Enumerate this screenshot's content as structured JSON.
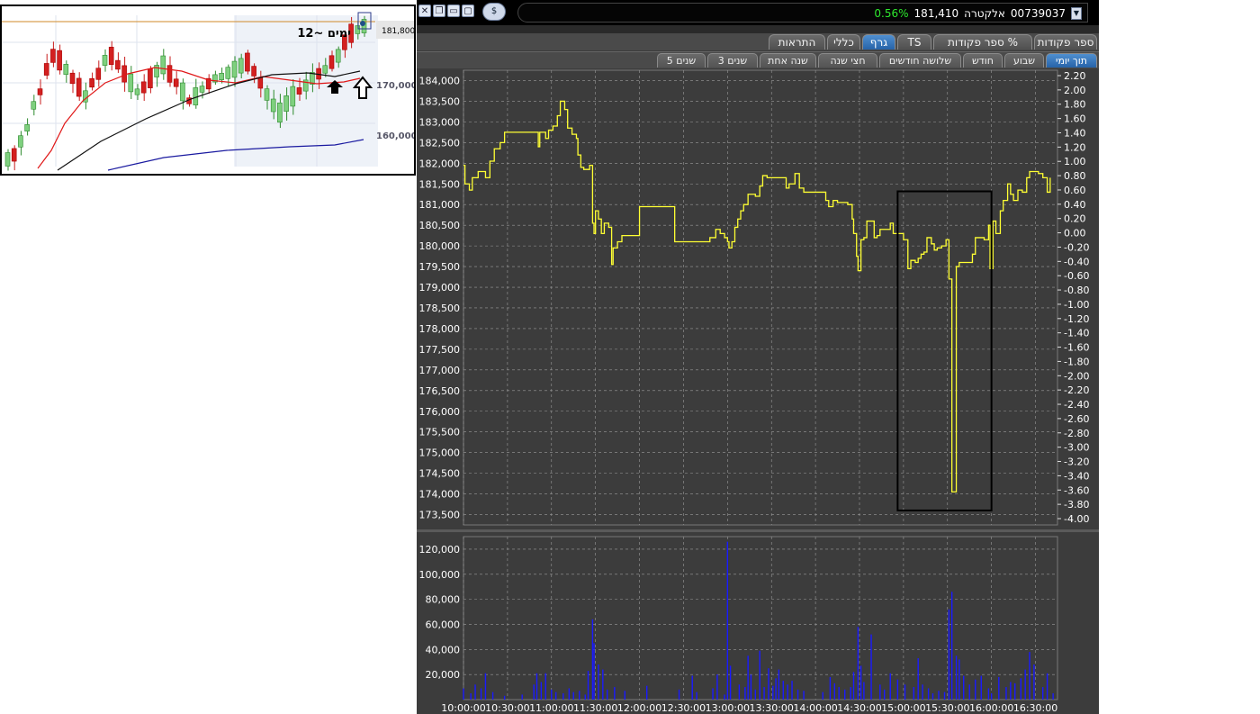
{
  "inset": {
    "annotation": "12~ ימים",
    "price_tag": "181,800",
    "y_labels": [
      "170,000",
      "160,000"
    ]
  },
  "window": {
    "buttons": [
      "close",
      "restore",
      "minimize",
      "maximize"
    ],
    "symbol_button": "$",
    "code": "00739037",
    "name": "אלקטרה",
    "price": "181,410",
    "change_pct": "0.56%"
  },
  "tabs": [
    {
      "label": "ספר פקודות",
      "active": false
    },
    {
      "label": "ספר פקודות %",
      "active": false
    },
    {
      "label": "TS",
      "active": false
    },
    {
      "label": "גרף",
      "active": true
    },
    {
      "label": "כללי",
      "active": false
    },
    {
      "label": "התראות",
      "active": false
    }
  ],
  "periods": [
    {
      "label": "תוך יומי",
      "active": true
    },
    {
      "label": "שבוע",
      "active": false
    },
    {
      "label": "חודש",
      "active": false
    },
    {
      "label": "שלושה חודשים",
      "active": false
    },
    {
      "label": "חצי שנה",
      "active": false
    },
    {
      "label": "שנה אחת",
      "active": false
    },
    {
      "label": "3 שנים",
      "active": false
    },
    {
      "label": "5 שנים",
      "active": false
    }
  ],
  "colors": {
    "chart_bg": "#3c3c3c",
    "grid": "#9a9a9a",
    "price_line": "#ffff33",
    "volume": "#1a1aff",
    "label": "#ffffff",
    "pct_green": "#2ee82e",
    "tab_active": "#2f72bb"
  },
  "chart_data": {
    "type": "line",
    "x_ticks": [
      "10:00:00",
      "10:30:00",
      "11:00:00",
      "11:30:00",
      "12:00:00",
      "12:30:00",
      "13:00:00",
      "13:30:00",
      "14:00:00",
      "14:30:00",
      "15:00:00",
      "15:30:00",
      "16:00:00",
      "16:30:00"
    ],
    "price": {
      "ylim": [
        173250,
        184250
      ],
      "ticks": [
        "184,000",
        "183,500",
        "183,000",
        "182,500",
        "182,000",
        "181,500",
        "181,000",
        "180,500",
        "180,000",
        "179,500",
        "179,000",
        "178,500",
        "178,000",
        "177,500",
        "177,000",
        "176,500",
        "176,000",
        "175,500",
        "175,000",
        "174,500",
        "174,000",
        "173,500"
      ],
      "pct_ticks": [
        "2.20",
        "2.00",
        "1.80",
        "1.60",
        "1.40",
        "1.20",
        "1.00",
        "0.80",
        "0.60",
        "0.40",
        "0.20",
        "0.00",
        "-0.20",
        "-0.40",
        "-0.60",
        "-0.80",
        "-1.00",
        "-1.20",
        "-1.40",
        "-1.60",
        "-1.80",
        "-2.00",
        "-2.20",
        "-2.40",
        "-2.60",
        "-2.80",
        "-3.00",
        "-3.20",
        "-3.40",
        "-3.60",
        "-3.80",
        "-4.00"
      ],
      "series": [
        [
          "10:00",
          181950
        ],
        [
          "10:01",
          181500
        ],
        [
          "10:04",
          181350
        ],
        [
          "10:06",
          181650
        ],
        [
          "10:10",
          181800
        ],
        [
          "10:15",
          181650
        ],
        [
          "10:18",
          182050
        ],
        [
          "10:21",
          182350
        ],
        [
          "10:25",
          182500
        ],
        [
          "10:28",
          182750
        ],
        [
          "10:50",
          182750
        ],
        [
          "10:51",
          182400
        ],
        [
          "10:52",
          182750
        ],
        [
          "10:56",
          182600
        ],
        [
          "10:58",
          182800
        ],
        [
          "11:01",
          182900
        ],
        [
          "11:04",
          183150
        ],
        [
          "11:06",
          183500
        ],
        [
          "11:09",
          183300
        ],
        [
          "11:11",
          182850
        ],
        [
          "11:14",
          182700
        ],
        [
          "11:17",
          182600
        ],
        [
          "11:18",
          182200
        ],
        [
          "11:20",
          181900
        ],
        [
          "11:22",
          181850
        ],
        [
          "11:26",
          181950
        ],
        [
          "11:28",
          180550
        ],
        [
          "11:29",
          180300
        ],
        [
          "11:30",
          180850
        ],
        [
          "11:32",
          180650
        ],
        [
          "11:34",
          180300
        ],
        [
          "11:36",
          180550
        ],
        [
          "11:39",
          180450
        ],
        [
          "11:41",
          179550
        ],
        [
          "11:42",
          179950
        ],
        [
          "11:45",
          180100
        ],
        [
          "11:48",
          180250
        ],
        [
          "11:56",
          180250
        ],
        [
          "12:00",
          180950
        ],
        [
          "12:10",
          180950
        ],
        [
          "12:22",
          180950
        ],
        [
          "12:24",
          180100
        ],
        [
          "12:30",
          180100
        ],
        [
          "12:44",
          180100
        ],
        [
          "12:48",
          180200
        ],
        [
          "12:52",
          180400
        ],
        [
          "12:55",
          180300
        ],
        [
          "12:58",
          180200
        ],
        [
          "13:00",
          180100
        ],
        [
          "13:01",
          179950
        ],
        [
          "13:03",
          180100
        ],
        [
          "13:05",
          180450
        ],
        [
          "13:07",
          180650
        ],
        [
          "13:09",
          180850
        ],
        [
          "13:11",
          181000
        ],
        [
          "13:14",
          181250
        ],
        [
          "13:19",
          181200
        ],
        [
          "13:22",
          181450
        ],
        [
          "13:24",
          181700
        ],
        [
          "13:27",
          181650
        ],
        [
          "13:38",
          181650
        ],
        [
          "13:40",
          181400
        ],
        [
          "13:42",
          181500
        ],
        [
          "13:46",
          181750
        ],
        [
          "13:49",
          181400
        ],
        [
          "13:52",
          181300
        ],
        [
          "14:05",
          181300
        ],
        [
          "14:07",
          181100
        ],
        [
          "14:09",
          180950
        ],
        [
          "14:12",
          181100
        ],
        [
          "14:15",
          181050
        ],
        [
          "14:20",
          181050
        ],
        [
          "14:22",
          181000
        ],
        [
          "14:25",
          180650
        ],
        [
          "14:26",
          180300
        ],
        [
          "14:28",
          179750
        ],
        [
          "14:29",
          179400
        ],
        [
          "14:31",
          180150
        ],
        [
          "14:33",
          180200
        ],
        [
          "14:35",
          180600
        ],
        [
          "14:38",
          180600
        ],
        [
          "14:40",
          180200
        ],
        [
          "14:42",
          180250
        ],
        [
          "14:44",
          180400
        ],
        [
          "14:49",
          180400
        ],
        [
          "14:51",
          180550
        ],
        [
          "14:53",
          180300
        ],
        [
          "14:58",
          180300
        ],
        [
          "15:00",
          180150
        ],
        [
          "15:03",
          179450
        ],
        [
          "15:05",
          179650
        ],
        [
          "15:08",
          179600
        ],
        [
          "15:10",
          179700
        ],
        [
          "15:12",
          179800
        ],
        [
          "15:14",
          179850
        ],
        [
          "15:16",
          180200
        ],
        [
          "15:19",
          180050
        ],
        [
          "15:21",
          179900
        ],
        [
          "15:23",
          179950
        ],
        [
          "15:26",
          180000
        ],
        [
          "15:29",
          180150
        ],
        [
          "15:31",
          179200
        ],
        [
          "15:33",
          174050
        ],
        [
          "15:36",
          179500
        ],
        [
          "15:38",
          179600
        ],
        [
          "15:44",
          179600
        ],
        [
          "15:47",
          179800
        ],
        [
          "15:49",
          180200
        ],
        [
          "15:55",
          180150
        ],
        [
          "15:58",
          180500
        ],
        [
          "15:59",
          179450
        ],
        [
          "16:01",
          180600
        ],
        [
          "16:03",
          180300
        ],
        [
          "16:06",
          180850
        ],
        [
          "16:08",
          181100
        ],
        [
          "16:11",
          181500
        ],
        [
          "16:13",
          181250
        ],
        [
          "16:15",
          181100
        ],
        [
          "16:18",
          181350
        ],
        [
          "16:21",
          181300
        ],
        [
          "16:24",
          181650
        ],
        [
          "16:26",
          181800
        ],
        [
          "16:32",
          181750
        ],
        [
          "16:35",
          181650
        ],
        [
          "16:38",
          181300
        ],
        [
          "16:40",
          181650
        ]
      ]
    },
    "volume": {
      "ylim": [
        0,
        130000
      ],
      "ticks": [
        "120,000",
        "100,000",
        "80,000",
        "60,000",
        "40,000",
        "20,000"
      ],
      "bars": [
        [
          "10:00",
          9000
        ],
        [
          "10:05",
          5000
        ],
        [
          "10:08",
          12000
        ],
        [
          "10:12",
          9000
        ],
        [
          "10:15",
          21000
        ],
        [
          "10:20",
          6000
        ],
        [
          "10:28",
          3000
        ],
        [
          "10:40",
          4000
        ],
        [
          "10:48",
          12000
        ],
        [
          "10:50",
          21000
        ],
        [
          "10:53",
          14000
        ],
        [
          "10:56",
          21000
        ],
        [
          "11:00",
          8000
        ],
        [
          "11:03",
          6000
        ],
        [
          "11:08",
          5000
        ],
        [
          "11:12",
          9000
        ],
        [
          "11:15",
          6000
        ],
        [
          "11:19",
          7000
        ],
        [
          "11:23",
          4000
        ],
        [
          "11:25",
          23000
        ],
        [
          "11:28",
          64000
        ],
        [
          "11:29",
          45000
        ],
        [
          "11:32",
          28000
        ],
        [
          "11:35",
          24000
        ],
        [
          "11:38",
          8000
        ],
        [
          "11:43",
          10000
        ],
        [
          "11:50",
          7000
        ],
        [
          "12:05",
          11000
        ],
        [
          "12:27",
          8000
        ],
        [
          "12:36",
          19000
        ],
        [
          "12:39",
          6000
        ],
        [
          "12:50",
          9000
        ],
        [
          "12:53",
          20000
        ],
        [
          "12:58",
          4000
        ],
        [
          "13:00",
          126000
        ],
        [
          "13:02",
          27000
        ],
        [
          "13:08",
          12000
        ],
        [
          "13:12",
          10000
        ],
        [
          "13:14",
          35000
        ],
        [
          "13:16",
          20000
        ],
        [
          "13:19",
          8000
        ],
        [
          "13:22",
          39000
        ],
        [
          "13:25",
          10000
        ],
        [
          "13:28",
          25000
        ],
        [
          "13:31",
          11000
        ],
        [
          "13:33",
          17000
        ],
        [
          "13:35",
          24000
        ],
        [
          "13:38",
          15000
        ],
        [
          "13:41",
          12000
        ],
        [
          "13:44",
          15000
        ],
        [
          "13:48",
          8000
        ],
        [
          "13:52",
          7000
        ],
        [
          "14:05",
          6000
        ],
        [
          "14:10",
          18000
        ],
        [
          "14:13",
          13000
        ],
        [
          "14:16",
          10000
        ],
        [
          "14:20",
          8000
        ],
        [
          "14:24",
          10000
        ],
        [
          "14:26",
          22000
        ],
        [
          "14:29",
          58000
        ],
        [
          "14:31",
          27000
        ],
        [
          "14:33",
          14000
        ],
        [
          "14:38",
          52000
        ],
        [
          "14:44",
          12000
        ],
        [
          "14:47",
          8000
        ],
        [
          "14:51",
          21000
        ],
        [
          "14:56",
          16000
        ],
        [
          "15:01",
          12000
        ],
        [
          "15:07",
          10000
        ],
        [
          "15:10",
          33000
        ],
        [
          "15:13",
          12000
        ],
        [
          "15:17",
          9000
        ],
        [
          "15:20",
          5000
        ],
        [
          "15:24",
          7000
        ],
        [
          "15:28",
          6000
        ],
        [
          "15:31",
          72000
        ],
        [
          "15:33",
          86000
        ],
        [
          "15:36",
          35000
        ],
        [
          "15:38",
          32000
        ],
        [
          "15:41",
          19000
        ],
        [
          "15:45",
          12000
        ],
        [
          "15:49",
          16000
        ],
        [
          "15:53",
          19000
        ],
        [
          "15:58",
          9000
        ],
        [
          "16:00",
          5000
        ],
        [
          "16:05",
          18000
        ],
        [
          "16:10",
          10000
        ],
        [
          "16:13",
          14000
        ],
        [
          "16:16",
          13000
        ],
        [
          "16:20",
          17000
        ],
        [
          "16:23",
          24000
        ],
        [
          "16:26",
          38000
        ],
        [
          "16:29",
          28000
        ],
        [
          "16:35",
          10000
        ],
        [
          "16:38",
          21000
        ],
        [
          "16:42",
          5000
        ]
      ]
    },
    "highlight": {
      "start": "14:56",
      "end": "16:00",
      "y_top": 181320,
      "y_bottom": 173600
    }
  }
}
